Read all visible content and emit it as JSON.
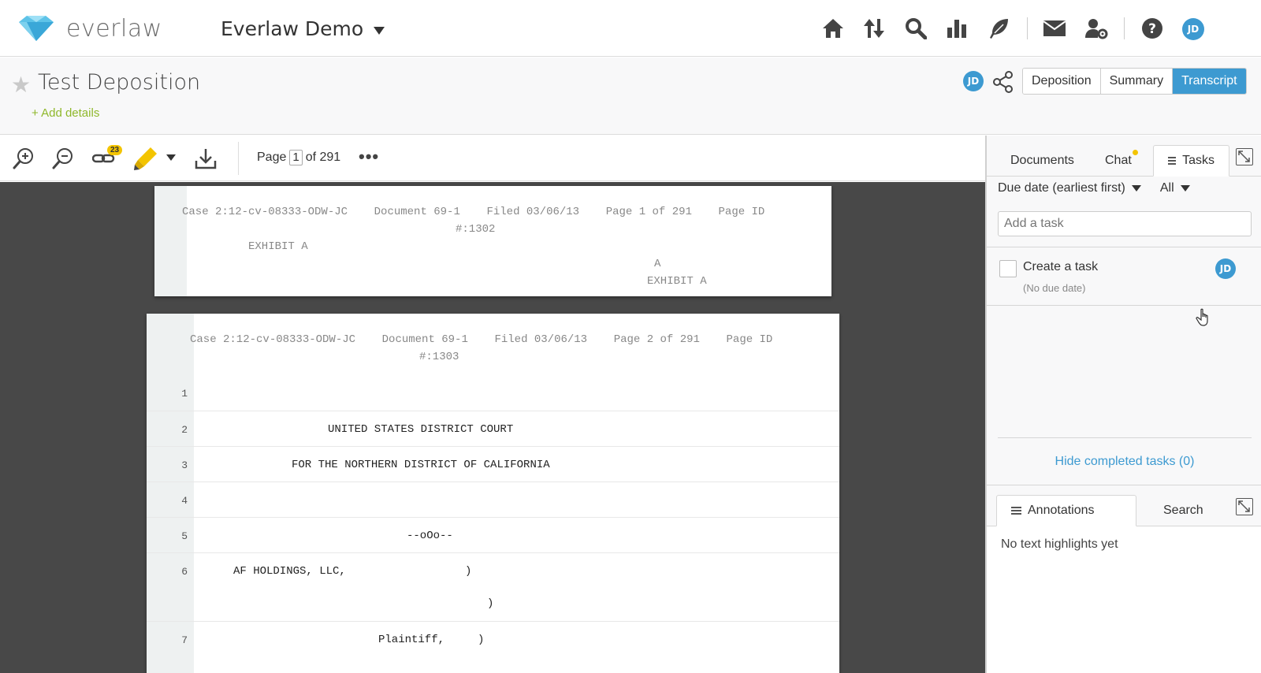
{
  "app": {
    "brand": "everlaw",
    "project": "Everlaw Demo",
    "user_initials": "JD",
    "accent": "#3d9ad1",
    "link_green": "#8fb82b"
  },
  "nav": {
    "icons": [
      "home-icon",
      "upload-download-icon",
      "search-icon",
      "analytics-icon",
      "feather-icon",
      "mail-icon",
      "user-settings-icon",
      "help-icon"
    ]
  },
  "title": {
    "text": "Test Deposition",
    "add_details": "+ Add details",
    "views": [
      "Deposition",
      "Summary",
      "Transcript"
    ],
    "active_view": "Transcript"
  },
  "toolbar": {
    "link_badge": "23",
    "page_label": "Page",
    "page_current": "1",
    "page_total": "of 291",
    "more": "•••"
  },
  "page1": {
    "header": "Case 2:12-cv-08333-ODW-JC    Document 69-1    Filed 03/06/13    Page 1 of 291    Page ID",
    "header2": "#:1302",
    "line_exhibit": "EXHIBIT A",
    "line_a": "A",
    "line_exhibit2": "EXHIBIT A"
  },
  "page2": {
    "header": "Case 2:12-cv-08333-ODW-JC    Document 69-1    Filed 03/06/13    Page 2 of 291    Page ID",
    "header2": "#:1303",
    "rows": [
      {
        "num": "1",
        "text": ""
      },
      {
        "num": "2",
        "text": "UNITED STATES DISTRICT COURT"
      },
      {
        "num": "3",
        "text": "FOR THE NORTHERN DISTRICT OF CALIFORNIA"
      },
      {
        "num": "4",
        "text": ""
      },
      {
        "num": "5",
        "text": "--oOo--"
      },
      {
        "num": "6",
        "text": "AF HOLDINGS, LLC,                  )"
      },
      {
        "num": "",
        "text": ")"
      },
      {
        "num": "7",
        "text": "Plaintiff,     )"
      }
    ]
  },
  "panel": {
    "tabs": [
      "Documents",
      "Chat",
      "Tasks"
    ],
    "active_tab": "Tasks",
    "sort_label": "Due date (earliest first)",
    "filter_label": "All",
    "task_placeholder": "Add a task",
    "task_name": "Create a task",
    "task_due": "(No due date)",
    "hide_completed": "Hide completed tasks (0)",
    "bottom_tabs": [
      "Annotations",
      "Search"
    ],
    "active_bottom_tab": "Annotations",
    "no_highlights": "No text highlights yet"
  }
}
